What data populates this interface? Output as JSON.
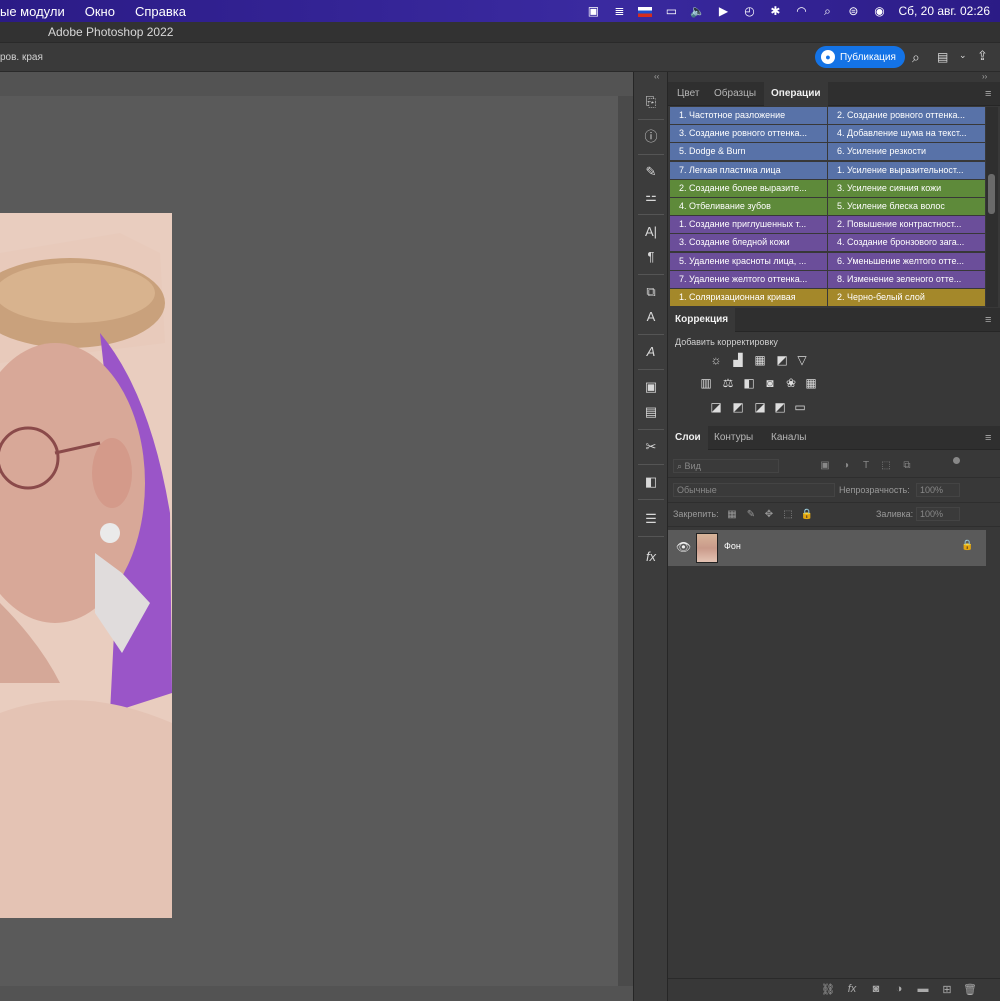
{
  "menubar": {
    "items": [
      "ые модули",
      "Окно",
      "Справка"
    ],
    "clock": "Сб, 20 авг.  02:26"
  },
  "titlebar": {
    "title": "Adobe Photoshop 2022"
  },
  "optionsbar": {
    "left_text": "ров. края",
    "publish_label": "Публикация"
  },
  "panels": {
    "top_tabs": [
      "Цвет",
      "Образцы",
      "Операции"
    ],
    "actions": [
      {
        "left": "1. Частотное разложение",
        "right": "2. Создание ровного оттенка...",
        "color": "#5872a8"
      },
      {
        "left": "3. Создание ровного оттенка...",
        "right": "4. Добавление шума на текст...",
        "color": "#5872a8"
      },
      {
        "left": "5. Dodge & Burn",
        "right": "6. Усиление резкости",
        "color": "#5872a8"
      },
      {
        "left": "7. Легкая пластика лица",
        "right": "1. Усиление выразительност...",
        "color": "#5872a8"
      },
      {
        "left": "2. Создание более выразите...",
        "right": "3. Усиление сияния кожи",
        "color": "#5e8a3a"
      },
      {
        "left": "4. Отбеливание зубов",
        "right": "5. Усиление блеска волос",
        "color": "#5e8a3a"
      },
      {
        "left": "1. Создание приглушенных т...",
        "right": "2. Повышение контрастност...",
        "color": "#6b4e9a"
      },
      {
        "left": "3. Создание бледной кожи",
        "right": "4. Создание бронзового зага...",
        "color": "#6b4e9a"
      },
      {
        "left": "5. Удаление красноты лица, ...",
        "right": "6. Уменьшение желтого отте...",
        "color": "#6b4e9a"
      },
      {
        "left": "7. Удаление желтого оттенка...",
        "right": "8. Изменение зеленого отте...",
        "color": "#6b4e9a"
      },
      {
        "left": "1. Соляризационная кривая",
        "right": "2. Черно-белый слой",
        "color": "#a4882a"
      }
    ],
    "correction_tab": "Коррекция",
    "add_adjustment": "Добавить корректировку",
    "layers_tabs": [
      "Слои",
      "Контуры",
      "Каналы"
    ],
    "kind_placeholder": "Вид",
    "blend_mode": "Обычные",
    "opacity_label": "Непрозрачность:",
    "opacity_value": "100%",
    "lock_label": "Закрепить:",
    "fill_label": "Заливка:",
    "fill_value": "100%",
    "layer_name": "Фон"
  }
}
